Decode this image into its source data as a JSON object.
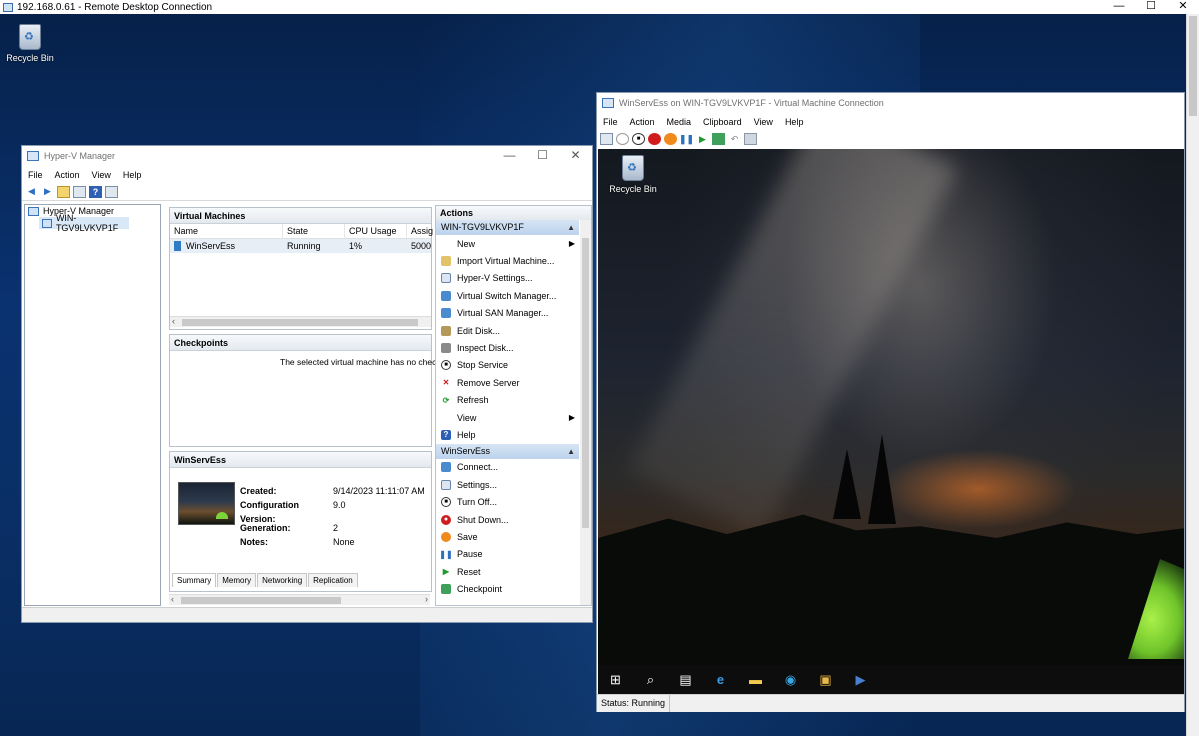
{
  "rdp": {
    "title": "192.168.0.61 - Remote Desktop Connection",
    "minimize": "—",
    "maximize": "☐",
    "close": "✕"
  },
  "desktop": {
    "recycle_bin_label": "Recycle Bin"
  },
  "hyperv_manager": {
    "title": "Hyper-V Manager",
    "menu": [
      "File",
      "Action",
      "View",
      "Help"
    ],
    "tree": {
      "root": "Hyper-V Manager",
      "server": "WIN-TGV9LVKVP1F"
    },
    "virtual_machines": {
      "header": "Virtual Machines",
      "columns": [
        "Name",
        "State",
        "CPU Usage",
        "Assig"
      ],
      "rows": [
        {
          "name": "WinServEss",
          "state": "Running",
          "cpu": "1%",
          "assigned": "5000"
        }
      ]
    },
    "checkpoints": {
      "header": "Checkpoints",
      "message": "The selected virtual machine has no checkp"
    },
    "summary": {
      "header": "WinServEss",
      "created_label": "Created:",
      "created_value": "9/14/2023 11:11:07 AM",
      "config_label": "Configuration Version:",
      "config_value": "9.0",
      "generation_label": "Generation:",
      "generation_value": "2",
      "notes_label": "Notes:",
      "notes_value": "None",
      "tabs": [
        "Summary",
        "Memory",
        "Networking",
        "Replication"
      ]
    },
    "actions": {
      "header": "Actions",
      "server_group": "WIN-TGV9LVKVP1F",
      "server_items": [
        "New",
        "Import Virtual Machine...",
        "Hyper-V Settings...",
        "Virtual Switch Manager...",
        "Virtual SAN Manager...",
        "Edit Disk...",
        "Inspect Disk...",
        "Stop Service",
        "Remove Server",
        "Refresh",
        "View",
        "Help"
      ],
      "vm_group": "WinServEss",
      "vm_items": [
        "Connect...",
        "Settings...",
        "Turn Off...",
        "Shut Down...",
        "Save",
        "Pause",
        "Reset",
        "Checkpoint"
      ]
    }
  },
  "vm_connection": {
    "title": "WinServEss on WIN-TGV9LVKVP1F - Virtual Machine Connection",
    "menu": [
      "File",
      "Action",
      "Media",
      "Clipboard",
      "View",
      "Help"
    ],
    "recycle_bin_label": "Recycle Bin",
    "status": "Status: Running"
  },
  "colors": {
    "accent": "#1b5fb4",
    "action_group_bg": "#c7daf0",
    "selection": "#d9e8f7"
  }
}
